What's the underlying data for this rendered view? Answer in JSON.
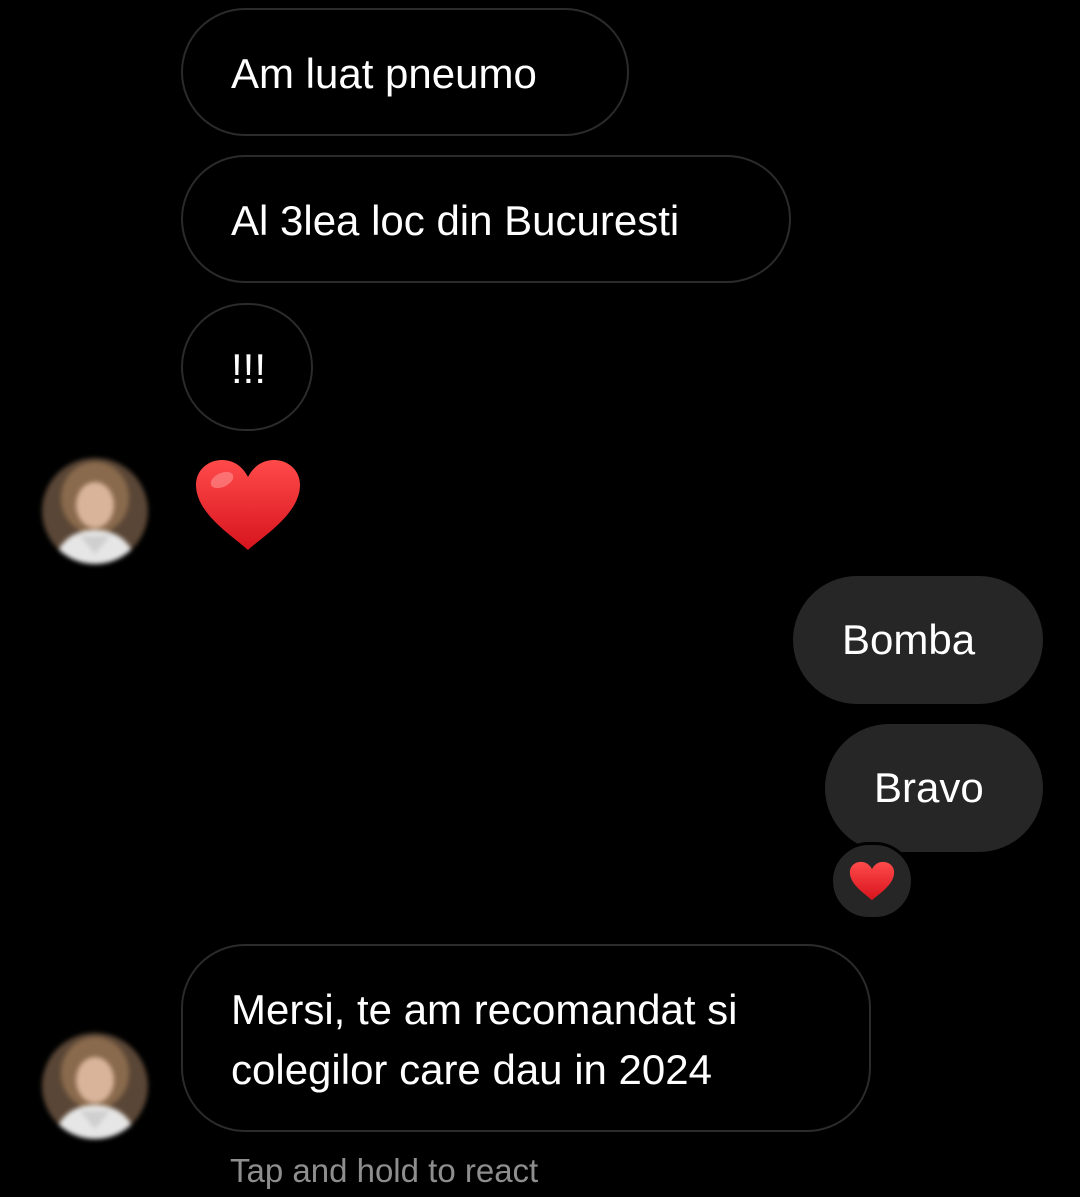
{
  "colors": {
    "background": "#000000",
    "incoming_border": "#2b2b2b",
    "outgoing_bubble": "#262626",
    "text": "#ffffff",
    "hint_text": "#8e8e8e",
    "heart": "#e0202a"
  },
  "messages": [
    {
      "direction": "incoming",
      "text": "Am luat pneumo"
    },
    {
      "direction": "incoming",
      "text": "Al 3lea loc din Bucuresti"
    },
    {
      "direction": "incoming",
      "text": "!!!"
    },
    {
      "direction": "incoming",
      "type": "emoji",
      "icon": "red-heart-icon"
    },
    {
      "direction": "outgoing",
      "text": "Bomba"
    },
    {
      "direction": "outgoing",
      "text": "Bravo",
      "reaction": "red-heart-icon"
    },
    {
      "direction": "incoming",
      "text_lines": [
        "Mersi, te am recomandat si",
        "colegilor care dau in 2024"
      ]
    }
  ],
  "footer": {
    "hint": "Tap and hold to react"
  }
}
